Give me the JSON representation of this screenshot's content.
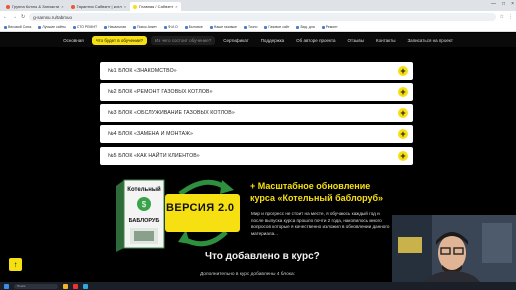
{
  "browser": {
    "tabs": [
      {
        "label": "Группа Котлы & Запчасти"
      },
      {
        "label": "Гарантия Сабвэнт | котл"
      },
      {
        "label": "Главная / Сабвэнт"
      }
    ],
    "url": "g-samsu.ru/tabmuo",
    "bookmarks": [
      "Весовой Союз",
      "Лучшие сайты",
      "СТО РЕМНТ",
      "Начальная",
      "Поиск Анкет",
      "Ф.И.О",
      "Бытовое",
      "Наше газовые",
      "Точно",
      "Газовое сайт",
      "Вид. для",
      "Ремонт"
    ]
  },
  "nav": {
    "items": [
      {
        "label": "Основная"
      },
      {
        "label": "Что будет в обучении?"
      },
      {
        "label": "Из чего состоит обучение?"
      },
      {
        "label": "Сертификат"
      },
      {
        "label": "Поддержка"
      },
      {
        "label": "Об авторе проекта"
      },
      {
        "label": "Отзывы"
      },
      {
        "label": "Контакты"
      },
      {
        "label": "Записаться на проект"
      }
    ]
  },
  "accordion": [
    {
      "label": "№1 БЛОК «ЗНАКОМСТВО»"
    },
    {
      "label": "№2 БЛОК «РЕМОНТ ГАЗОВЫХ КОТЛОВ»"
    },
    {
      "label": "№3 БЛОК «ОБСЛУЖИВАНИЕ ГАЗОВЫХ КОТЛОВ»"
    },
    {
      "label": "№4 БЛОК «ЗАМЕНА И МОНТАЖ»"
    },
    {
      "label": "№5 БЛОК «КАК НАЙТИ КЛИЕНТОВ»"
    }
  ],
  "promo": {
    "product_name_line1": "Котельный",
    "product_name_line2": "БАБЛОРУБ",
    "version_label": "ВЕРСИЯ 2.0",
    "title_part1": "+ Масштабное обновление",
    "title_part2": "курса «Котельный баблоруб»",
    "text": "Мир и прогресс не стоит на месте, я обучаюсь каждый год и после выпуска курса прошло почти 2 года, накопилось много вопросов которые я качественно изложил в обновлении данного материала..."
  },
  "section": {
    "title": "Что добавлено в курс?",
    "subtitle": "Дополнительно в курс добавлены 4 блока:"
  },
  "taskbar": {
    "search_placeholder": "Поиск"
  },
  "colors": {
    "accent": "#f7e012",
    "background": "#000000",
    "card": "#ffffff"
  }
}
